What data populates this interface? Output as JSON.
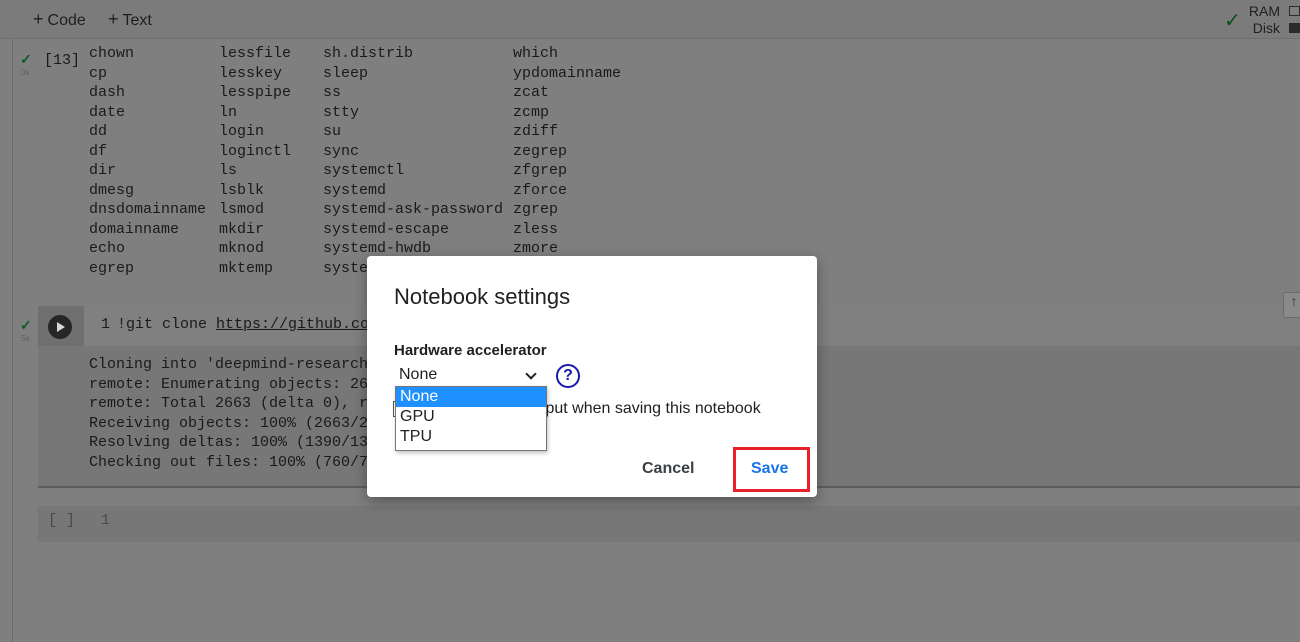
{
  "toolbar": {
    "code_label": "Code",
    "text_label": "Text",
    "ram_label": "RAM",
    "disk_label": "Disk"
  },
  "cell1": {
    "exec_count": "[13]",
    "time": "0s",
    "rows": [
      [
        "chown",
        "lessfile",
        "sh.distrib",
        "which"
      ],
      [
        "cp",
        "lesskey",
        "sleep",
        "ypdomainname"
      ],
      [
        "dash",
        "lesspipe",
        "ss",
        "zcat"
      ],
      [
        "date",
        "ln",
        "stty",
        "zcmp"
      ],
      [
        "dd",
        "login",
        "su",
        "zdiff"
      ],
      [
        "df",
        "loginctl",
        "sync",
        "zegrep"
      ],
      [
        "dir",
        "ls",
        "systemctl",
        "zfgrep"
      ],
      [
        "dmesg",
        "lsblk",
        "systemd",
        "zforce"
      ],
      [
        "dnsdomainname",
        "lsmod",
        "systemd-ask-password",
        "zgrep"
      ],
      [
        "domainname",
        "mkdir",
        "systemd-escape",
        "zless"
      ],
      [
        "echo",
        "mknod",
        "systemd-hwdb",
        "zmore"
      ],
      [
        "egrep",
        "mktemp",
        "syste",
        ""
      ]
    ]
  },
  "cell2": {
    "time": "5s",
    "line_number": "1",
    "code_prefix": "!git clone ",
    "code_link": "https://github.com",
    "output": [
      "Cloning into 'deepmind-research'",
      "remote: Enumerating objects: 266",
      "remote: Total 2663 (delta 0), re",
      "Receiving objects: 100% (2663/26",
      "Resolving deltas: 100% (1390/139",
      "Checking out files: 100% (760/76"
    ]
  },
  "cell3": {
    "bracket": "[ ]",
    "line_number": "1"
  },
  "dialog": {
    "title": "Notebook settings",
    "hardware_label": "Hardware accelerator",
    "selected_value": "None",
    "help_symbol": "?",
    "omit_text": "tput when saving this notebook",
    "cancel_label": "Cancel",
    "save_label": "Save",
    "options": [
      "None",
      "GPU",
      "TPU"
    ]
  }
}
